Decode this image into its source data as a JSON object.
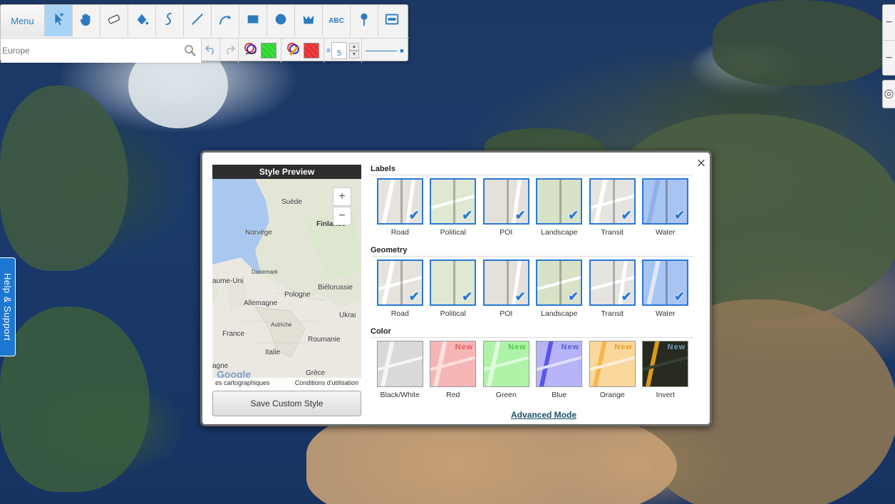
{
  "toolbar": {
    "menu_label": "Menu",
    "tools": [
      {
        "name": "select-tool",
        "icon": "pointer-move-icon",
        "active": true
      },
      {
        "name": "pan-tool",
        "icon": "hand-icon",
        "active": false
      },
      {
        "name": "eraser-tool",
        "icon": "eraser-icon",
        "active": false
      },
      {
        "name": "fill-tool",
        "icon": "paint-bucket-icon",
        "active": false
      },
      {
        "name": "freehand-tool",
        "icon": "curve-icon",
        "active": false
      },
      {
        "name": "line-tool",
        "icon": "line-icon",
        "active": false
      },
      {
        "name": "route-tool",
        "icon": "route-icon",
        "active": false
      },
      {
        "name": "rectangle-tool",
        "icon": "rectangle-icon",
        "active": false
      },
      {
        "name": "circle-tool",
        "icon": "circle-icon",
        "active": false
      },
      {
        "name": "polygon-tool",
        "icon": "polygon-icon",
        "active": false
      },
      {
        "name": "text-tool",
        "icon": "text-icon",
        "label": "ABC",
        "active": false
      },
      {
        "name": "marker-tool",
        "icon": "pin-icon",
        "active": false
      },
      {
        "name": "style-tool",
        "icon": "map-style-icon",
        "active": true
      }
    ],
    "search": {
      "placeholder": "Europe",
      "value": ""
    },
    "stroke_color": "#33dd33",
    "fill_color": "#ee3333",
    "stroke_width": "5"
  },
  "help_tab_label": "Help & Support",
  "dialog": {
    "preview_title": "Style Preview",
    "preview_map": {
      "labels": [
        "Suède",
        "Finlande",
        "Norvège",
        "Danemark",
        "aume-Uni",
        "Pologne",
        "Biélorussie",
        "Allemagne",
        "Ukrai",
        "Autriche",
        "France",
        "Roumanie",
        "Italie",
        "Grèce",
        "agne"
      ],
      "zoom_in": "+",
      "zoom_out": "−",
      "logo": "Google",
      "attribution_left": "es cartographiques",
      "attribution_right": "Conditions d'utilisation"
    },
    "save_button": "Save Custom Style",
    "sections": {
      "labels": {
        "title": "Labels",
        "tiles": [
          {
            "label": "Road",
            "checked": true
          },
          {
            "label": "Political",
            "checked": true
          },
          {
            "label": "POI",
            "checked": true
          },
          {
            "label": "Landscape",
            "checked": true
          },
          {
            "label": "Transit",
            "checked": true
          },
          {
            "label": "Water",
            "checked": true
          }
        ]
      },
      "geometry": {
        "title": "Geometry",
        "tiles": [
          {
            "label": "Road",
            "checked": true
          },
          {
            "label": "Political",
            "checked": true
          },
          {
            "label": "POI",
            "checked": true
          },
          {
            "label": "Landscape",
            "checked": true
          },
          {
            "label": "Transit",
            "checked": true
          },
          {
            "label": "Water",
            "checked": true
          }
        ]
      },
      "color": {
        "title": "Color",
        "tiles": [
          {
            "label": "Black/White",
            "checked": false
          },
          {
            "label": "Red",
            "checked": false
          },
          {
            "label": "Green",
            "checked": false
          },
          {
            "label": "Blue",
            "checked": false
          },
          {
            "label": "Orange",
            "checked": false
          },
          {
            "label": "Invert",
            "checked": false
          }
        ]
      }
    },
    "advanced_mode": "Advanced Mode",
    "close_label": "×",
    "accent_color": "#2979d6"
  }
}
